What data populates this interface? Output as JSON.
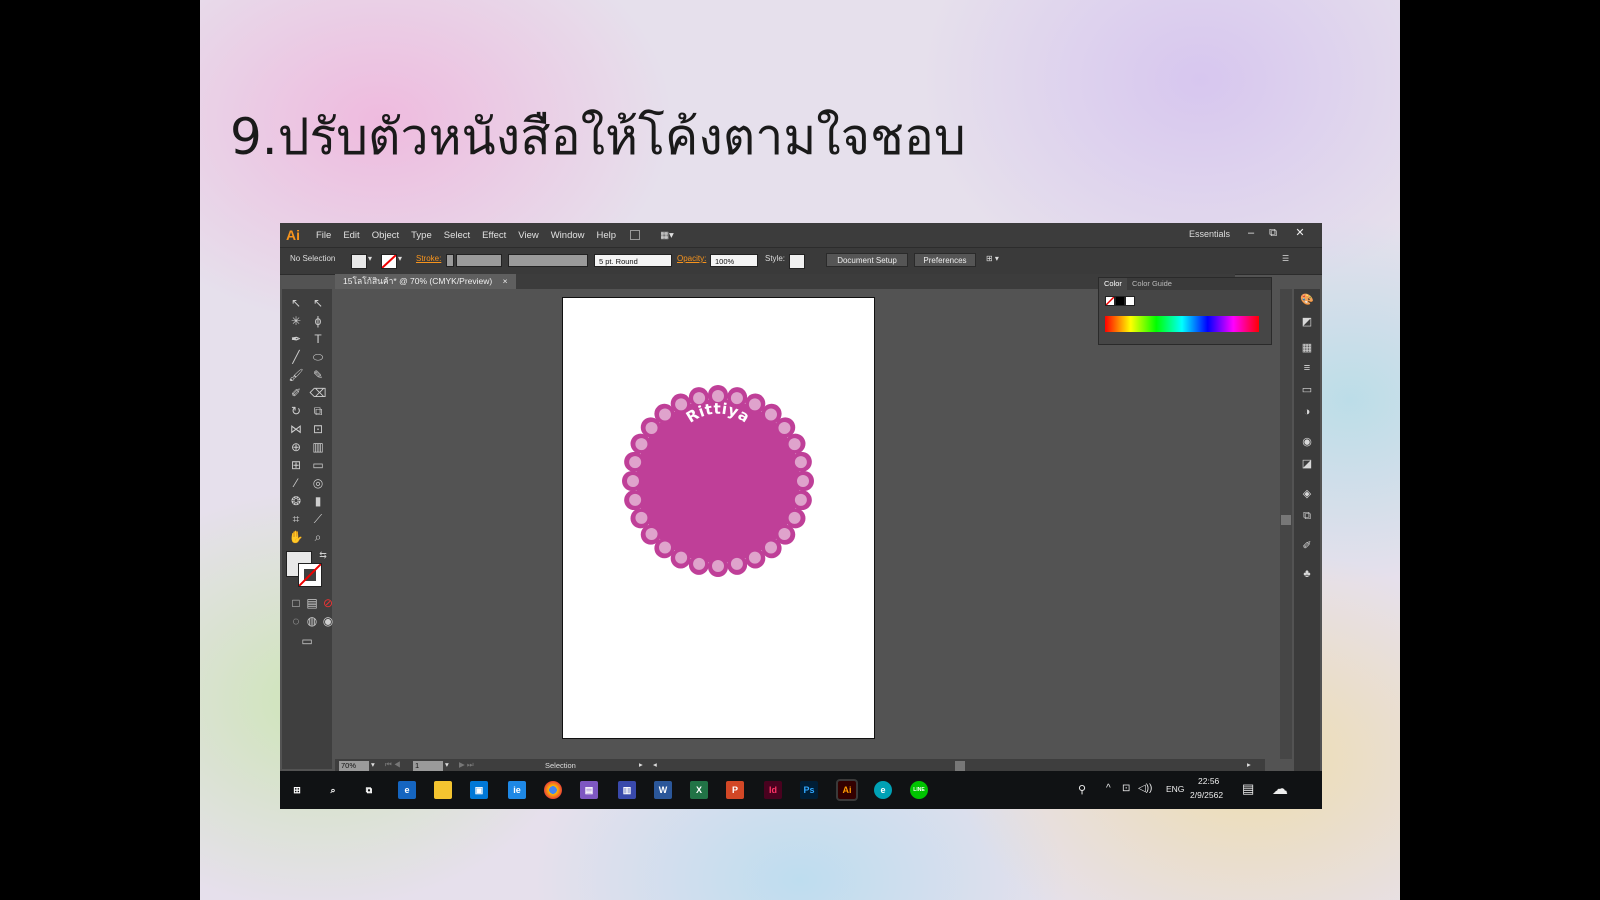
{
  "slide": {
    "title": "9.ปรับตัวหนังสือให้โค้งตามใจชอบ"
  },
  "app": {
    "logo": "Ai",
    "menu": [
      "File",
      "Edit",
      "Object",
      "Type",
      "Select",
      "Effect",
      "View",
      "Window",
      "Help"
    ],
    "workspace": "Essentials",
    "window_buttons": [
      "–",
      "⧉",
      "✕"
    ]
  },
  "control_bar": {
    "selection": "No Selection",
    "stroke_label": "Stroke:",
    "brush": "5 pt. Round",
    "opacity_label": "Opacity:",
    "opacity_value": "100%",
    "style_label": "Style:",
    "document_setup": "Document Setup",
    "preferences": "Preferences"
  },
  "document": {
    "tab_title": "15โลโก้สินค้า* @ 70% (CMYK/Preview)",
    "tab_close": "×"
  },
  "artwork": {
    "badge_text": "Rittiya",
    "badge_color": "#bf3f98",
    "dot_color": "#dfa3cc"
  },
  "color_panel": {
    "tabs": [
      "Color",
      "Color Guide"
    ]
  },
  "status_bar": {
    "zoom": "70%",
    "page": "1",
    "tool": "Selection"
  },
  "taskbar": {
    "apps": [
      "e",
      "ie",
      "chrome",
      "W",
      "X",
      "P",
      "Id",
      "Ps",
      "Ai",
      "e",
      "LINE"
    ],
    "language": "ENG",
    "time": "22:56",
    "date": "2/9/2562"
  }
}
